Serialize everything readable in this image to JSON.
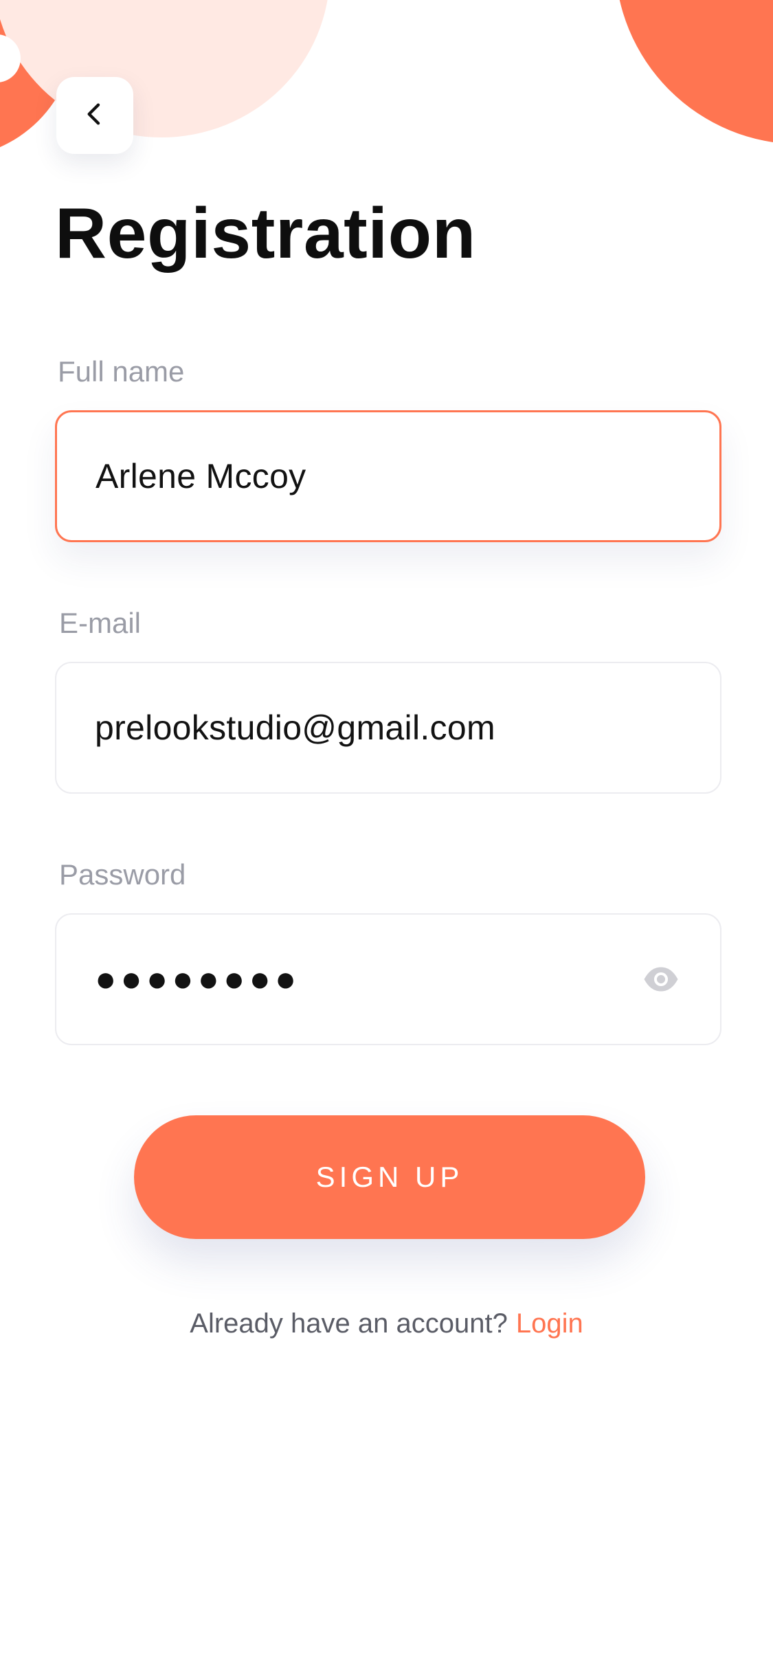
{
  "colors": {
    "accent": "#FF7551",
    "accent_light": "#FFE9E3",
    "label": "#9A9CA6",
    "text": "#121212"
  },
  "header": {
    "back_icon": "chevron-left-icon"
  },
  "page": {
    "title": "Registration"
  },
  "form": {
    "full_name": {
      "label": "Full name",
      "value": "Arlene Mccoy"
    },
    "email": {
      "label": "E-mail",
      "value": "prelookstudio@gmail.com"
    },
    "password": {
      "label": "Password",
      "masked_value": "●●●●●●●●",
      "toggle_icon": "eye-icon"
    }
  },
  "actions": {
    "signup_label": "SIGN UP"
  },
  "footer": {
    "prompt": "Already have an account?",
    "login_label": "Login"
  }
}
